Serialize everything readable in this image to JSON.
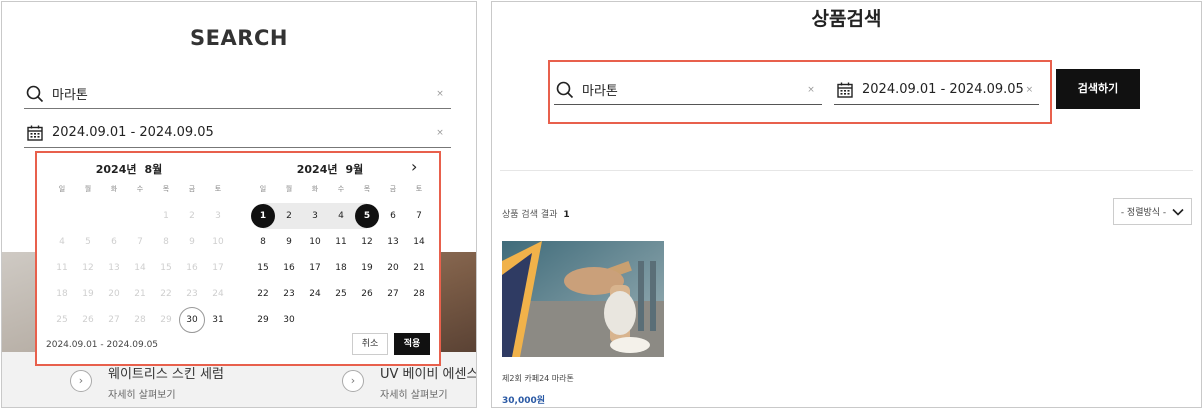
{
  "left": {
    "title": "SEARCH",
    "search": {
      "value": "마라톤",
      "clear": "×"
    },
    "date": {
      "value": "2024.09.01 - 2024.09.05",
      "clear": "×"
    },
    "calendar": {
      "next": "›",
      "months": [
        {
          "year": "2024년",
          "month": "8월",
          "weekdays": [
            "일",
            "월",
            "화",
            "수",
            "목",
            "금",
            "토"
          ],
          "weeks": [
            [
              "",
              "",
              "",
              "",
              "1",
              "2",
              "3"
            ],
            [
              "4",
              "5",
              "6",
              "7",
              "8",
              "9",
              "10"
            ],
            [
              "11",
              "12",
              "13",
              "14",
              "15",
              "16",
              "17"
            ],
            [
              "18",
              "19",
              "20",
              "21",
              "22",
              "23",
              "24"
            ],
            [
              "25",
              "26",
              "27",
              "28",
              "29",
              "30",
              "31"
            ]
          ]
        },
        {
          "year": "2024년",
          "month": "9월",
          "weekdays": [
            "일",
            "월",
            "화",
            "수",
            "목",
            "금",
            "토"
          ],
          "weeks": [
            [
              "1",
              "2",
              "3",
              "4",
              "5",
              "6",
              "7"
            ],
            [
              "8",
              "9",
              "10",
              "11",
              "12",
              "13",
              "14"
            ],
            [
              "15",
              "16",
              "17",
              "18",
              "19",
              "20",
              "21"
            ],
            [
              "22",
              "23",
              "24",
              "25",
              "26",
              "27",
              "28"
            ],
            [
              "29",
              "30",
              "",
              "",
              "",
              "",
              ""
            ]
          ]
        }
      ],
      "range_text": "2024.09.01 - 2024.09.05",
      "cancel": "취소",
      "apply": "적용"
    },
    "bg_products": [
      {
        "name": "웨이트리스 스킨 세럼",
        "link": "자세히 살펴보기",
        "arrow": "›"
      },
      {
        "name": "UV 베이비 에센스 SF",
        "link": "자세히 살펴보기",
        "arrow": "›"
      }
    ]
  },
  "right": {
    "title": "상품검색",
    "search": {
      "value": "마라톤",
      "clear": "×"
    },
    "date": {
      "value": "2024.09.01 - 2024.09.05",
      "clear": "×"
    },
    "search_button": "검색하기",
    "result_label": "상품 검색 결과",
    "result_count": "1",
    "sort_label": "- 정렬방식 -",
    "product": {
      "name": "제2회 카페24 마라톤",
      "price": "30,000원"
    }
  },
  "colors": {
    "highlight": "#e8604c",
    "price": "#2b5aa5",
    "button": "#111111"
  }
}
